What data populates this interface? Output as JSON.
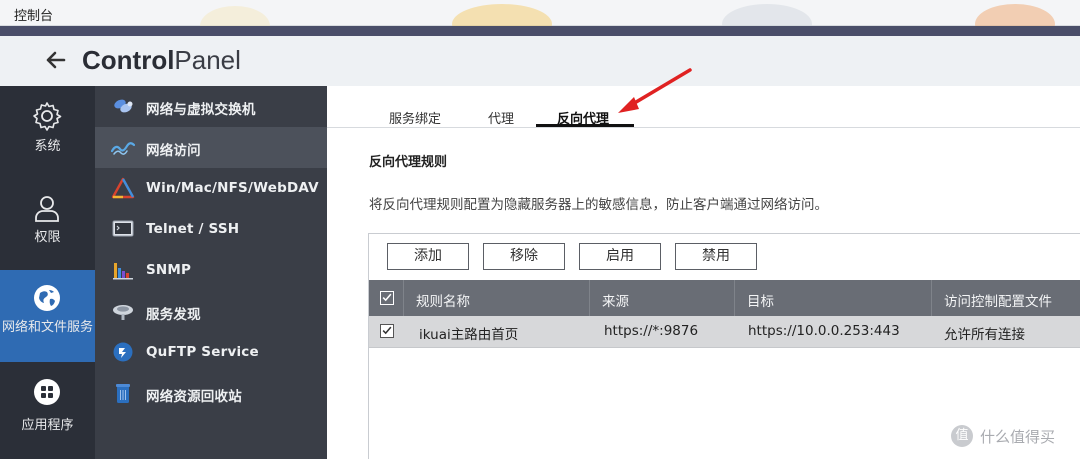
{
  "os_bar": {
    "title": "控制台"
  },
  "header": {
    "title_bold": "Control",
    "title_light": "Panel"
  },
  "main_nav": [
    {
      "label": "系统",
      "icon": "gear-icon"
    },
    {
      "label": "权限",
      "icon": "user-icon"
    },
    {
      "label": "网络和文件服务",
      "icon": "globe-icon",
      "active": true
    },
    {
      "label": "应用程序",
      "icon": "apps-icon"
    }
  ],
  "sub_nav": [
    {
      "label": "网络与虚拟交换机",
      "icon": "network-switch-icon"
    },
    {
      "label": "网络访问",
      "icon": "network-access-icon",
      "active": true
    },
    {
      "label": "Win/Mac/NFS/WebDAV",
      "icon": "file-share-icon"
    },
    {
      "label": "Telnet / SSH",
      "icon": "terminal-icon"
    },
    {
      "label": "SNMP",
      "icon": "snmp-icon"
    },
    {
      "label": "服务发现",
      "icon": "service-discovery-icon"
    },
    {
      "label": "QuFTP Service",
      "icon": "ftp-icon"
    },
    {
      "label": "网络资源回收站",
      "icon": "recycle-bin-icon"
    }
  ],
  "tabs": [
    {
      "label": "服务绑定"
    },
    {
      "label": "代理"
    },
    {
      "label": "反向代理",
      "active": true
    }
  ],
  "section": {
    "title": "反向代理规则",
    "description": "将反向代理规则配置为隐藏服务器上的敏感信息，防止客户端通过网络访问。"
  },
  "toolbar": {
    "add": "添加",
    "remove": "移除",
    "enable": "启用",
    "disable": "禁用"
  },
  "table": {
    "columns": [
      "规则名称",
      "来源",
      "目标",
      "访问控制配置文件"
    ],
    "rows": [
      {
        "checked": true,
        "name": "ikuai主路由首页",
        "source": "https://*:9876",
        "target": "https://10.0.0.253:443",
        "acl": "允许所有连接"
      }
    ]
  },
  "watermark": {
    "text": "什么值得买",
    "icon_glyph": "值"
  },
  "colors": {
    "accent": "#2f6bb3",
    "annotation_arrow": "#e02222",
    "sidebar": "#2b2f38",
    "table_header": "#696d75"
  }
}
